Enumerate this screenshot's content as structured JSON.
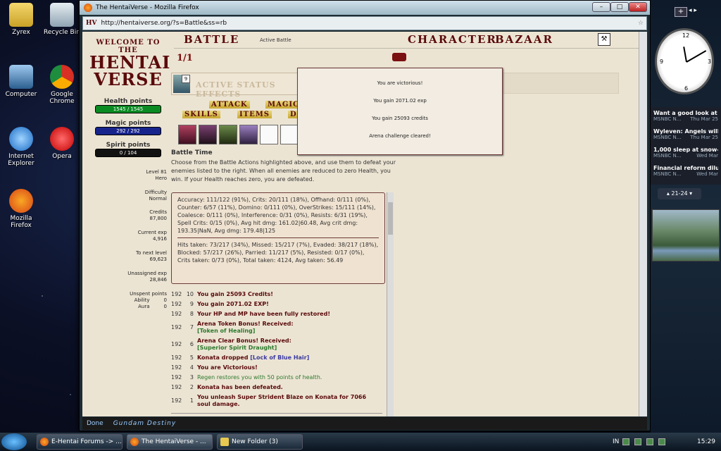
{
  "desktop": {
    "icons": [
      {
        "label": "Zyrex"
      },
      {
        "label": "Recycle Bin"
      },
      {
        "label": "Computer"
      },
      {
        "label": "Google Chrome"
      },
      {
        "label": "Internet Explorer"
      },
      {
        "label": "Opera"
      },
      {
        "label": "Mozilla Firefox"
      }
    ]
  },
  "browser": {
    "title": "The HentaiVerse - Mozilla Firefox",
    "url": "http://hentaiverse.org/?s=Battle&ss=rb",
    "status": "Done",
    "status_logo": "Gundam Destiny",
    "controls": {
      "minimize": "–",
      "maximize": "□",
      "close": "✕"
    }
  },
  "hv": {
    "welcome_line1": "WELCOME TO THE",
    "welcome_line2": "HENTAI",
    "welcome_line3": "VERSE",
    "health_label": "Health points",
    "health_value": "1545 / 1545",
    "health_fraction": 1.0,
    "magic_label": "Magic points",
    "magic_value": "292 / 292",
    "magic_fraction": 1.0,
    "spirit_label": "Spirit points",
    "spirit_value": "0 / 104",
    "spirit_fraction": 0.0,
    "level": "Level 81",
    "class": "Hero",
    "difficulty_label": "Difficulty",
    "difficulty_value": "Normal",
    "credits_label": "Credits",
    "credits_value": "87,800",
    "exp_label": "Current exp",
    "exp_value": "4,916",
    "next_label": "To next level",
    "next_value": "69,623",
    "unassigned_label": "Unassigned exp",
    "unassigned_value": "28,846",
    "unspent_label": "Unspent points",
    "ability_label": "Ability",
    "ability_value": "0",
    "aura_label": "Aura",
    "aura_value": "0",
    "nav": {
      "battle": "BATTLE",
      "battle_sub": "Active Battle",
      "character": "CHARACTER",
      "bazaar": "BAZAAR"
    },
    "round": "1/1",
    "status_num": "9",
    "status_effects_label": "ACTIVE STATUS EFFECTS",
    "actions": {
      "attack": "ATTACK",
      "magic": "MAGIC",
      "skills": "SKILLS",
      "items": "ITEMS",
      "defend": "DEFEND"
    },
    "battle_time_title": "Battle Time",
    "battle_time_text": "Choose from the Battle Actions highlighted above, and use them to defeat your enemies listed to the right. When all enemies are reduced to zero Health, you win. If your Health reaches zero, you are defeated.",
    "stats1": "Accuracy: 111/122 (91%), Crits: 20/111 (18%), Offhand: 0/111 (0%), Counter: 6/57 (11%), Domino: 0/111 (0%), OverStrikes: 15/111 (14%), Coalesce: 0/111 (0%), Interference: 0/31 (0%), Resists: 6/31 (19%), Spell Crits: 0/15 (0%), Avg hit dmg: 161.02|60.48, Avg crit dmg: 193.35|NaN, Avg dmg: 179.48|125",
    "stats2": "Hits taken: 73/217 (34%), Missed: 15/217 (7%), Evaded: 38/217 (18%), Blocked: 57/217 (26%), Parried: 11/217 (5%), Resisted: 0/17 (0%), Crits taken: 0/73 (0%), Total taken: 4124, Avg taken: 56.49",
    "log": [
      {
        "turn": "192",
        "seq": "10",
        "text": "You gain 25093 Credits!"
      },
      {
        "turn": "192",
        "seq": "9",
        "text": "You gain 2071.02 EXP!"
      },
      {
        "turn": "192",
        "seq": "8",
        "text": "Your HP and MP have been fully restored!"
      },
      {
        "turn": "192",
        "seq": "7",
        "text": "Arena Token Bonus! Received:",
        "item": "[Token of Healing]"
      },
      {
        "turn": "192",
        "seq": "6",
        "text": "Arena Clear Bonus! Received:",
        "item": "[Superior Spirit Draught]"
      },
      {
        "turn": "192",
        "seq": "5",
        "text": "Konata dropped",
        "item": "[Lock of Blue Hair]"
      },
      {
        "turn": "192",
        "seq": "4",
        "text": "You are Victorious!"
      },
      {
        "turn": "192",
        "seq": "3",
        "text": "Regen restores you with 50 points of health."
      },
      {
        "turn": "192",
        "seq": "2",
        "text": "Konata has been defeated."
      },
      {
        "turn": "192",
        "seq": "1",
        "text": "You unleash Super Strident Blaze on Konata for 7066 soul damage."
      }
    ],
    "popup": {
      "line1": "You are victorious!",
      "line2": "You gain 2071.02 exp",
      "line3": "You gain 25093 credits",
      "line4": "Arena challenge cleared!"
    }
  },
  "sidebar": {
    "plus": "+",
    "news": [
      {
        "headline": "Want a good look at ...",
        "source": "MSNBC N...",
        "date": "Thu Mar 25"
      },
      {
        "headline": "Wyleven: Angels will ...",
        "source": "MSNBC N...",
        "date": "Thu Mar 25"
      },
      {
        "headline": "1,000 sleep at snow-...",
        "source": "MSNBC N...",
        "date": "Wed Mar"
      },
      {
        "headline": "Financial reform dilu...",
        "source": "MSNBC N...",
        "date": "Wed Mar"
      }
    ],
    "pager": "21-24",
    "clock_numbers": [
      "12",
      "3",
      "6",
      "9"
    ]
  },
  "taskbar": {
    "tasks": [
      {
        "label": "E-Hentai Forums -> ..."
      },
      {
        "label": "The HentaiVerse - ..."
      },
      {
        "label": "New Folder (3)"
      }
    ],
    "lang": "IN",
    "time": "15:29"
  }
}
